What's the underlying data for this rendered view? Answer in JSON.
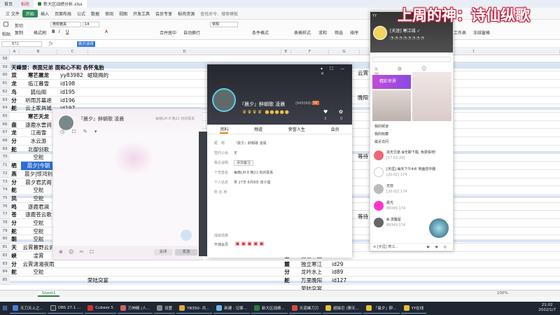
{
  "titlebar": {
    "tabs": [
      "首页",
      "稻壳",
      "新大区战绩分析.xlsx"
    ]
  },
  "menubar": {
    "items": [
      "三 文件",
      "开始",
      "插入",
      "页面布局",
      "公式",
      "数据",
      "审阅",
      "视图",
      "开发工具",
      "会员专享",
      "稻壳资源",
      "查找命令、搜索模板"
    ]
  },
  "ribbon": {
    "paste": "粘贴",
    "cut": "剪切",
    "copy": "复制",
    "format_painter": "格式刷",
    "font_name": "微软雅黑",
    "font_size": "14",
    "merge": "合并居中",
    "wrap": "自动换行",
    "normal": "常规",
    "cond_format": "条件格式",
    "table_style": "表格样式",
    "sum": "求和",
    "filter": "筛选",
    "sort": "排序",
    "fill": "填充",
    "cells": "单元格",
    "rows_cols": "行和列",
    "worksheet": "工作表",
    "freeze": "冻结窗格"
  },
  "formula": {
    "namebox": "B72",
    "content": "晨夕|会帘"
  },
  "columns": [
    "A",
    "B",
    "C",
    "D",
    "E",
    "F",
    "G",
    "H",
    "I"
  ],
  "grid": {
    "rows": [
      {
        "n": "58",
        "a": "",
        "b": "",
        "c": ""
      },
      {
        "n": "59",
        "a": "天峰盟",
        "b": "表面兄弟 面和心不和 各怀鬼胎"
      },
      {
        "n": "60",
        "a": "双",
        "b": "寒芒屠龙",
        "c": "yy83982",
        "d": "岷晓揭的"
      },
      {
        "n": "61",
        "a": "龙",
        "b": "临江暮雪",
        "c": "id198"
      },
      {
        "n": "62",
        "a": "鸟",
        "b": "狐仙阁",
        "c": "id195"
      },
      {
        "n": "63",
        "a": "分",
        "b": "听雨苏幕遮",
        "c": "id196"
      },
      {
        "n": "64",
        "a": "舵",
        "b": "云上家具城",
        "c": "id197"
      },
      {
        "n": "65",
        "b": "寒芒天龙"
      },
      {
        "n": "66",
        "a": "盘",
        "b": "逐鹿水雲涧"
      },
      {
        "n": "67",
        "a": "龙",
        "b": "江南雪"
      },
      {
        "n": "68",
        "a": "分",
        "b": "水云游"
      },
      {
        "n": "69",
        "a": "舵",
        "b": "北御剑歌"
      },
      {
        "n": "70",
        "b": "空舵"
      },
      {
        "n": "71",
        "a": "栖",
        "b": "晨夕|今朝"
      },
      {
        "n": "72",
        "a": "燕",
        "b": "晨夕|惊鸿别"
      },
      {
        "n": "73",
        "a": "分",
        "b": "晨夕君武阁"
      },
      {
        "n": "74",
        "a": "舵",
        "b": "空舵"
      },
      {
        "n": "75",
        "a": "凤",
        "b": "空舵"
      },
      {
        "n": "76",
        "a": "鸣",
        "b": "逐鹿君澜"
      },
      {
        "n": "77",
        "a": "苍",
        "b": "逐鹿苍云歌"
      },
      {
        "n": "78",
        "a": "分",
        "b": "空舵"
      },
      {
        "n": "79",
        "a": "舵",
        "b": "空舵"
      },
      {
        "n": "80",
        "a": "朝",
        "b": "空舵"
      },
      {
        "n": "81",
        "a": "天",
        "b": "云霄暮野云涧"
      },
      {
        "n": "82",
        "a": "峡",
        "b": "凌霄"
      },
      {
        "n": "83",
        "a": "分",
        "b": "云霄潇湘夜雨"
      },
      {
        "n": "84",
        "a": "舵",
        "b": "空舵"
      },
      {
        "n": "85",
        "b": "",
        "c": "",
        "d": "荣陆突宴"
      }
    ],
    "right_rows": [
      {
        "a": "雲",
        "b": "盛世帝王",
        "c": "id59"
      },
      {
        "a": "麓",
        "b": "独立寒江",
        "c": "id29"
      },
      {
        "a": "分",
        "b": "龙吟水上",
        "c": "id89"
      },
      {
        "a": "舵",
        "b": "万里晚阳",
        "c": "id127"
      },
      {
        "b": "荣陆突宴"
      }
    ],
    "far_right": [
      "云霄",
      "晚阳",
      "等待",
      "等待"
    ]
  },
  "chat": {
    "name": "『晨夕』醉朝歌 凌晨",
    "subtitle": "每晚LM 8 晚21 有的联系",
    "input_placeholder": "",
    "close_label": "关闭",
    "send_label": "发送"
  },
  "profile": {
    "nickname": "『晨夕』醉朝歌 凌晨",
    "qq": "(845068)",
    "level_badge": "LV",
    "stat_likes": "3",
    "stat_gifts": "0",
    "tabs": [
      "资料",
      "频道",
      "荣誉人生",
      "会员"
    ],
    "fields": [
      {
        "k": "昵　称",
        "v": "『晨夕』醉朝歌 凌晨"
      },
      {
        "k": "签约公会",
        "v": "无"
      },
      {
        "k": "靠近说明",
        "v": "添加备注"
      },
      {
        "k": "个性签名",
        "v": "每晚LM 8 晚21 有的联系"
      },
      {
        "k": "个人信息",
        "v": "男  27岁  6月8日  双子座"
      },
      {
        "k": "所 在 地",
        "v": ""
      }
    ],
    "footer_label": "成就勋章",
    "open_label": "开通会员"
  },
  "qq": {
    "title": "YY",
    "user": "[天涯] 寒江城 ✓",
    "section": "精彩世界",
    "list_headers": [
      "我的频道",
      "我的收藏",
      "最近访问"
    ],
    "contacts": [
      {
        "name": "造天兄弟 ✿无聊下载, 免费看吧!",
        "sub": "[17:53:20]"
      },
      {
        "name": "[天涯] 每天下午4点 地面控中路",
        "sub": "[20:02]  174"
      },
      {
        "name": "无双",
        "sub": "[20:02]  174"
      },
      {
        "name": "晨光",
        "sub": "89349  174"
      },
      {
        "name": "✿ 滨雁留",
        "sub": "89349  174"
      }
    ],
    "bottom_label": "[天涯] 寒江..."
  },
  "overlay": {
    "text": "上周的神：诗仙纵歌"
  },
  "sheetbar": {
    "tab": "Sheet1",
    "zoom": "100%"
  },
  "taskbar": {
    "apps": [
      "天刀天上之...",
      "OBS 27.1 ...",
      "Cubase 5",
      "万神殿 (人...",
      "设置",
      "YB350- 共...",
      "新建 - 记事...",
      "新大区战绩...",
      "天道峰刀刃",
      "超级巨 (聊天...",
      "「晨夕」醉...",
      "YY在线"
    ],
    "time": "21:02",
    "date": "2022/1/7"
  }
}
